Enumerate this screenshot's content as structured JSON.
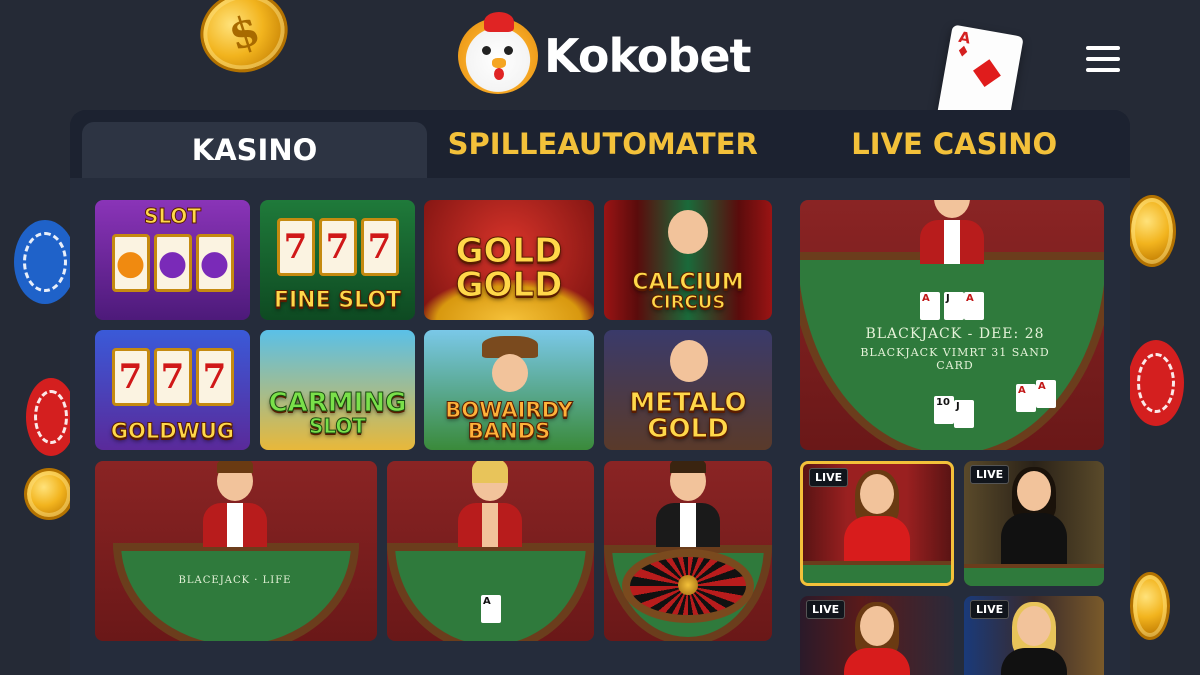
{
  "header": {
    "brand": "Kokobet",
    "menu_icon": "hamburger-menu-icon"
  },
  "tabs": [
    {
      "label": "KASINO",
      "active": true
    },
    {
      "label": "SPILLEAUTOMATER",
      "active": false
    },
    {
      "label": "LIVE CASINO",
      "active": false
    }
  ],
  "slots": [
    {
      "top": "SLOT",
      "title": "",
      "reels": [
        "",
        "",
        ""
      ]
    },
    {
      "top": "",
      "title": "FINE SLOT",
      "reels": [
        "7",
        "7",
        "7"
      ]
    },
    {
      "top": "",
      "title_l1": "GOLD",
      "title_l2": "GOLD"
    },
    {
      "top": "",
      "title_l1": "CALCIUM",
      "title_l2": "CIRCUS"
    },
    {
      "top": "",
      "title": "GOLDWUG",
      "reels": [
        "7",
        "7",
        "7"
      ]
    },
    {
      "top": "",
      "title_l1": "CARMING",
      "title_l2": "SLOT"
    },
    {
      "top": "",
      "title_l1": "BOWAIRDY",
      "title_l2": "BANDS"
    },
    {
      "top": "",
      "title_l1": "METALO",
      "title_l2": "GOLD"
    }
  ],
  "featured_table": {
    "line1": "BLACKJACK - DEE: 28",
    "line2": "BLACKJACK VIMRT 31 SAND CARD"
  },
  "tables": [
    {
      "label": "BLACEJACK · LIFE"
    },
    {
      "label": ""
    },
    {
      "label": ""
    }
  ],
  "live": [
    {
      "badge": "LIVE",
      "selected": true
    },
    {
      "badge": "LIVE",
      "selected": false
    },
    {
      "badge": "LIVE",
      "selected": false
    },
    {
      "badge": "LIVE",
      "selected": false
    }
  ],
  "colors": {
    "background": "#252a36",
    "panel": "#1c2230",
    "accent": "#f3c13a",
    "felt": "#2f7a3c"
  }
}
